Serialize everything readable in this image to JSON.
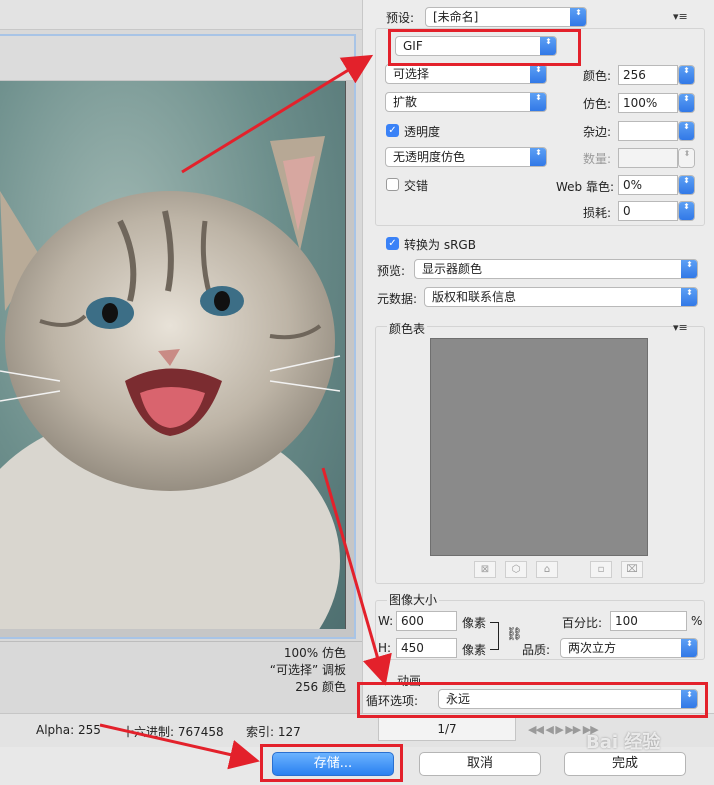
{
  "preview": {
    "info_lines": [
      "100% 仿色",
      "“可选择” 调板",
      "256 颜色"
    ]
  },
  "settings": {
    "preset_label": "预设:",
    "preset_value": "[未命名]",
    "format_value": "GIF",
    "reduction_value": "可选择",
    "dither_value": "扩散",
    "transparency_label": "透明度",
    "transparency_checked": true,
    "transparency_dither_value": "无透明度仿色",
    "interlaced_label": "交错",
    "interlaced_checked": false,
    "colors_label": "颜色:",
    "colors_value": "256",
    "dither_label": "仿色:",
    "dither_amount": "100%",
    "matte_label": "杂边:",
    "matte_value": "",
    "amount_label": "数量:",
    "amount_value": "",
    "web_snap_label": "Web 靠色:",
    "web_snap_value": "0%",
    "lossy_label": "损耗:",
    "lossy_value": "0",
    "convert_srgb_label": "转换为 sRGB",
    "convert_srgb_checked": true,
    "preview_label": "预览:",
    "preview_value": "显示器颜色",
    "metadata_label": "元数据:",
    "metadata_value": "版权和联系信息",
    "color_table_label": "颜色表",
    "image_size_label": "图像大小",
    "width_label": "W:",
    "width_value": "600",
    "height_label": "H:",
    "height_value": "450",
    "pixels_unit": "像素",
    "percent_label": "百分比:",
    "percent_value": "100",
    "percent_sign": "%",
    "quality_label": "品质:",
    "quality_value": "两次立方",
    "animation_label": "动画",
    "loop_label": "循环选项:",
    "loop_value": "永远",
    "chevron_glyph": "⬍",
    "menu_glyph": "▾≡"
  },
  "status": {
    "alpha": "Alpha: 255",
    "hex": "十六进制: 767458",
    "index": "索引: 127",
    "frame": "1/7",
    "anim_controls": "◀◀ ◀ ▶ ▶▶ ▶▶"
  },
  "buttons": {
    "save": "存储...",
    "cancel": "取消",
    "done": "完成"
  },
  "watermark": "Bai 经验"
}
